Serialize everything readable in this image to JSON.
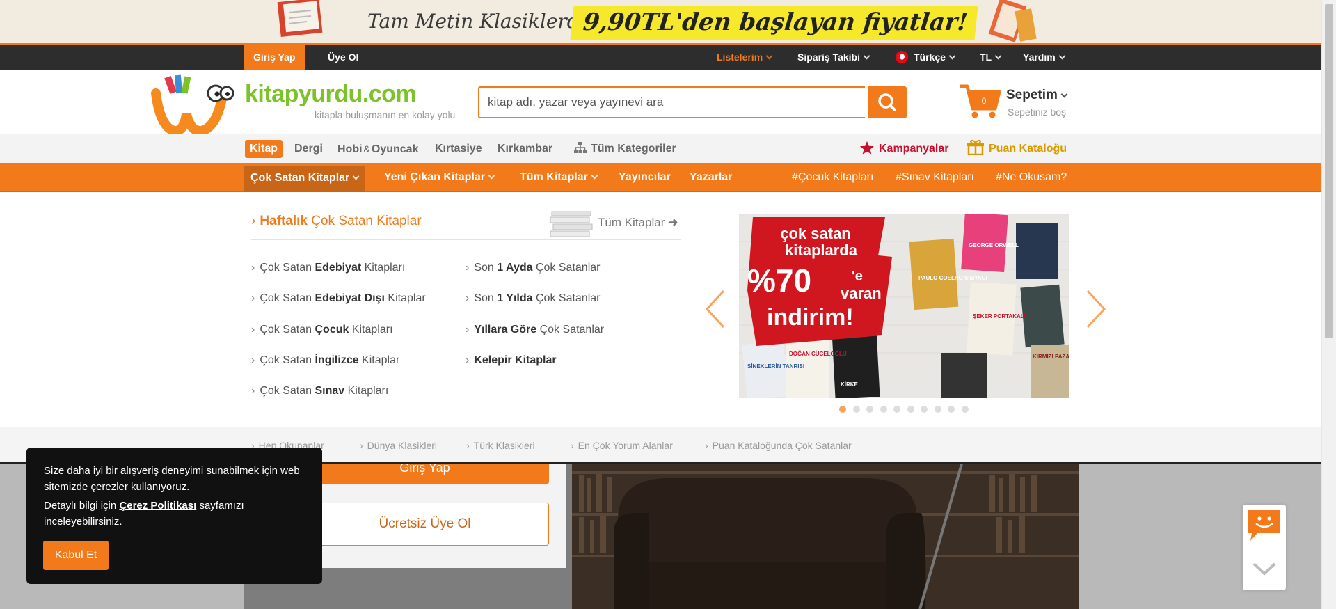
{
  "promo": {
    "text_prefix": "Tam Metin Klasiklerde",
    "text_highlight": "9,90TL'den başlayan fiyatlar!"
  },
  "topbar": {
    "login": "Giriş Yap",
    "signup": "Üye Ol",
    "lists": "Listelerim",
    "order_tracking": "Sipariş Takibi",
    "language": "Türkçe",
    "currency": "TL",
    "help": "Yardım"
  },
  "header": {
    "logo_text": "kitapyurdu.com",
    "tagline": "kitapla buluşmanın en kolay yolu",
    "search_placeholder": "kitap adı, yazar veya yayınevi ara",
    "search_value": "",
    "cart_count": "0",
    "cart_title": "Sepetim",
    "cart_status": "Sepetiniz boş"
  },
  "categories": {
    "items": [
      "Kitap",
      "Dergi",
      "Hobi",
      "Oyuncak",
      "Kırtasiye",
      "Kırkambar",
      "Tüm Kategoriler"
    ],
    "amp": "&",
    "campaigns": "Kampanyalar",
    "points_catalog": "Puan Kataloğu"
  },
  "nav": {
    "items": [
      "Çok Satan Kitaplar",
      "Yeni Çıkan Kitaplar",
      "Tüm Kitaplar",
      "Yayıncılar",
      "Yazarlar"
    ],
    "tags": [
      "Çocuk Kitapları",
      "Sınav Kitapları",
      "Ne Okusam?"
    ],
    "hash": "#"
  },
  "mega": {
    "title_bold": "Haftalık",
    "title_rest": "Çok Satan Kitaplar",
    "all_books": "Tüm Kitaplar",
    "left": [
      {
        "pre": "Çok Satan ",
        "bold": "Edebiyat",
        "post": " Kitapları"
      },
      {
        "pre": "Çok Satan ",
        "bold": "Edebiyat Dışı",
        "post": " Kitaplar"
      },
      {
        "pre": "Çok Satan ",
        "bold": "Çocuk",
        "post": " Kitapları"
      },
      {
        "pre": "Çok Satan ",
        "bold": "İngilizce",
        "post": " Kitaplar"
      },
      {
        "pre": "Çok Satan ",
        "bold": "Sınav",
        "post": " Kitapları"
      }
    ],
    "right": [
      {
        "pre": "Son ",
        "bold": "1 Ayda",
        "post": " Çok Satanlar"
      },
      {
        "pre": "Son ",
        "bold": "1 Yılda",
        "post": " Çok Satanlar"
      },
      {
        "pre": "",
        "bold": "Yıllara Göre",
        "post": " Çok Satanlar"
      },
      {
        "pre": "",
        "bold": "Kelepir Kitaplar",
        "post": ""
      }
    ]
  },
  "slider": {
    "line1": "çok satan",
    "line2": "kitaplarda",
    "pct": "%70",
    "suffix": "'e",
    "varan": "varan",
    "indirim": "indirim!",
    "covers": [
      {
        "text": "PAULO COELHO SİMYACI",
        "color": "#d9a53a"
      },
      {
        "text": "GEORGE ORWELL",
        "color": "#e8407a"
      },
      {
        "text": "ŞEKER PORTAKALI",
        "color": "#f4efe4"
      },
      {
        "text": "SİNEKLERİN TANRISI",
        "color": "#eaeef2"
      },
      {
        "text": "DOĞAN CÜCELOĞLU",
        "color": "#f5f2ea"
      },
      {
        "text": "KİRKE",
        "color": "#1f1f1f"
      },
      {
        "text": "KIRMIZI PAZARTESİ",
        "color": "#c8b795"
      }
    ],
    "slide_count": 10,
    "active_slide": 0
  },
  "quick_links": [
    "Hep Okunanlar",
    "Dünya Klasikleri",
    "Türk Klasikleri",
    "En Çok Yorum Alanlar",
    "Puan Kataloğunda Çok Satanlar"
  ],
  "lower": {
    "login_btn": "Giriş Yap",
    "free_signup": "Ücretsiz Üye Ol"
  },
  "cookie": {
    "text1": "Size daha iyi bir alışveriş deneyimi sunabilmek için web sitemizde çerezler kullanıyoruz.",
    "text2_pre": "Detaylı bilgi için",
    "policy_link": "Çerez Politikası",
    "text2_post": "sayfamızı inceleyebilirsiniz.",
    "accept": "Kabul Et"
  },
  "colors": {
    "brand_orange": "#f27a1a",
    "logo_green": "#7cc229",
    "campaign_red": "#c8102e",
    "points_gold": "#d99a00"
  }
}
